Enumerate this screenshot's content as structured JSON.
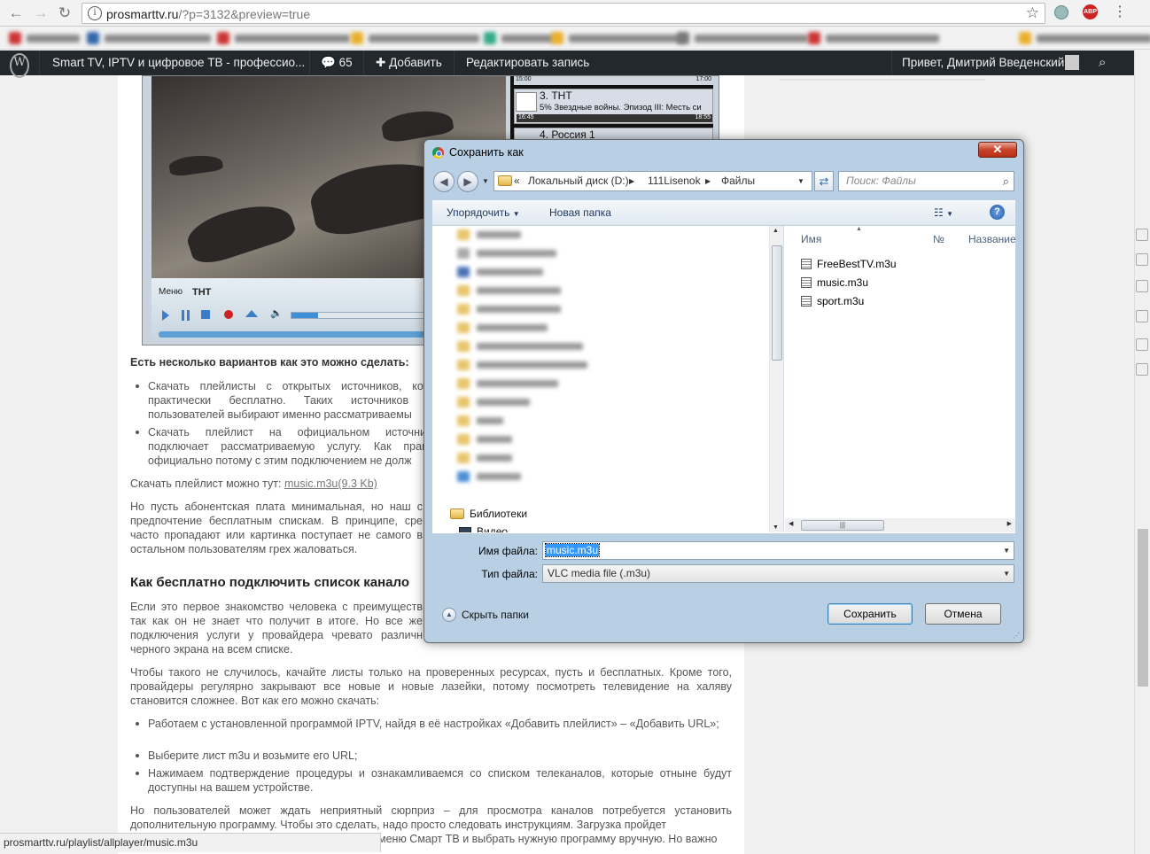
{
  "browser": {
    "url_host": "prosmarttv.ru",
    "url_rest": "/?p=3132&preview=true"
  },
  "adminbar": {
    "site_title": "Smart TV, IPTV и цифровое ТВ - профессио...",
    "comments_count": "65",
    "add_label": "Добавить",
    "edit_label": "Редактировать запись",
    "greeting": "Привет, Дмитрий Введенский"
  },
  "player": {
    "menu_label": "Меню",
    "channel_label": "ТНТ",
    "channels": [
      {
        "title": "3. ТНТ",
        "subtitle": "5% Звездные войны. Эпизод III: Месть си",
        "time_start": "16:45",
        "time_end": "18:55",
        "top_times": [
          "15:00",
          "17:00"
        ]
      },
      {
        "title": "4. Россия 1"
      }
    ]
  },
  "article": {
    "heading_options": "Есть несколько вариантов как это можно сделать:",
    "list1": [
      "Скачать плейлисты с открытых источников, котор практически бесплатно. Таких источников мн пользователей выбирают именно рассматриваемы",
      "Скачать плейлист на официальном источнике, подключает рассматриваемую услугу. Как правил официально потому с этим подключением не долж"
    ],
    "download_prefix": "Скачать плейлист можно тут: ",
    "download_link": "music.m3u(9.3 Kb)",
    "para1": "Но пусть абонентская плата минимальная, но наш с предпочтение бесплатным спискам. В принципе, сре часто пропадают или картинка поступает не самого в остальном пользователям грех жаловаться.",
    "h3": "Как бесплатно подключить список канало",
    "para2": "Если это первое знакомство человека с преимуществ так как он не знает что получит в итоге. Но все же подключения услуги у провайдера чревато различн черного экрана на всем списке.",
    "para3": "Чтобы такого не случилось, качайте листы только на проверенных ресурсах, пусть и бесплатных. Кроме того, провайдеры регулярно закрывают все новые и новые лазейки, потому посмотреть телевидение на халяву становится сложнее. Вот как его можно скачать:",
    "list2": [
      "Работаем с установленной программой IPTV, найдя в её настройках «Добавить плейлист» – «Добавить URL»;",
      "Выберите лист m3u и возьмите его URL;",
      "Нажимаем подтверждение процедуры и ознакамливаемся со списком телеканалов, которые отныне будут доступны на вашем устройстве."
    ],
    "para4": "Но пользователей может ждать неприятный сюрприз – для просмотра каналов потребуется установить дополнительную программу. Чтобы это сделать, надо просто следовать инструкциям. Загрузка пройдет",
    "para4b": "меню Смарт ТВ и выбрать нужную программу вручную. Но важно"
  },
  "statusbar": "prosmarttv.ru/playlist/allplayer/music.m3u",
  "dialog": {
    "title": "Сохранить как",
    "breadcrumb": [
      "«",
      "Локальный диск (D:)",
      "111Lisenok",
      "Файлы"
    ],
    "search_placeholder": "Поиск: Файлы",
    "organize": "Упорядочить",
    "new_folder": "Новая папка",
    "libraries": "Библиотеки",
    "video": "Видео",
    "col_name": "Имя",
    "col_num": "№",
    "col_title": "Название",
    "files": [
      "FreeBestTV.m3u",
      "music.m3u",
      "sport.m3u"
    ],
    "filename_label": "Имя файла:",
    "filename_value": "music.m3u",
    "filetype_label": "Тип файла:",
    "filetype_value": "VLC media file (.m3u)",
    "hide_folders": "Скрыть папки",
    "save": "Сохранить",
    "cancel": "Отмена"
  }
}
